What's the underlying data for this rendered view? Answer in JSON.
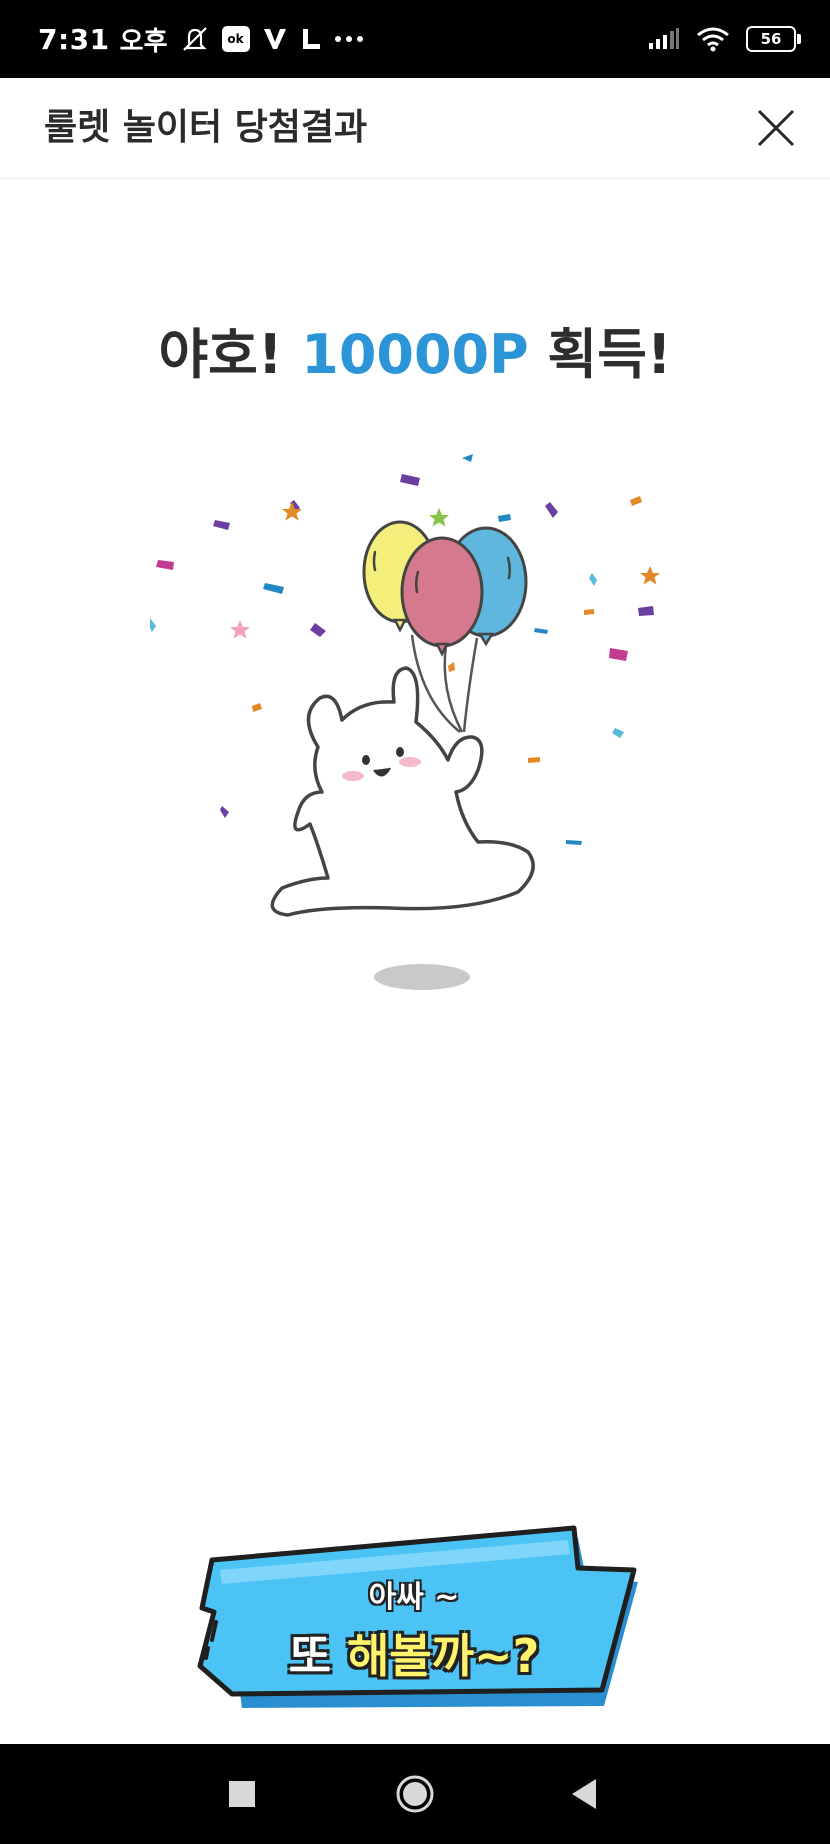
{
  "status_bar": {
    "time": "7:31",
    "ampm": "오후",
    "badge": "ok",
    "battery": "56"
  },
  "header": {
    "title": "룰렛 놀이터 당첨결과"
  },
  "result": {
    "prefix": "야호!",
    "points": "10000P",
    "suffix": "획득!"
  },
  "cta": {
    "line1": "아싸 ~",
    "line2_part1": "또",
    "line2_highlight": "해볼까~?"
  },
  "colors": {
    "accent": "#2b95d8",
    "cta_fill": "#4cc3f5",
    "highlight": "#fff36b"
  },
  "icons": {
    "close": "close-icon",
    "nav_recent": "square-icon",
    "nav_home": "circle-icon",
    "nav_back": "triangle-back-icon"
  }
}
